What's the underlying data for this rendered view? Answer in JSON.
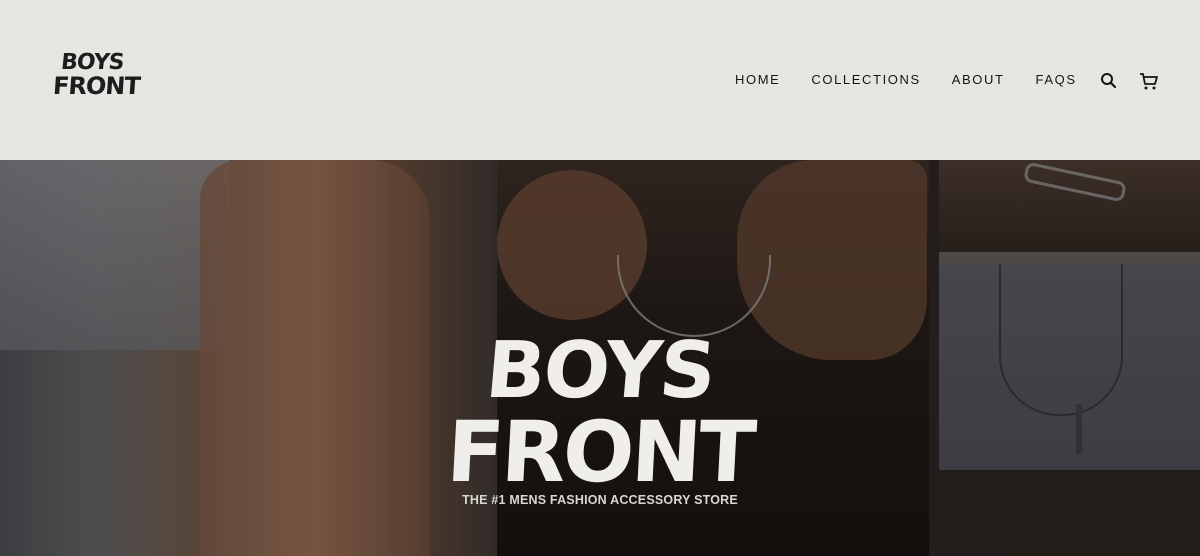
{
  "header": {
    "logo_line1": "BOYS",
    "logo_line2": "FRONT",
    "nav": [
      "HOME",
      "COLLECTIONS",
      "ABOUT",
      "FAQS"
    ],
    "icons": [
      "search-icon",
      "cart-icon"
    ]
  },
  "hero": {
    "title_line1": "BOYS",
    "title_line2": "FRONT",
    "tagline": "THE #1 MENS FASHION ACCESSORY STORE"
  },
  "colors": {
    "header_bg": "#e7e5e1",
    "text_dark": "#151515",
    "hero_text": "#efeeeb"
  }
}
